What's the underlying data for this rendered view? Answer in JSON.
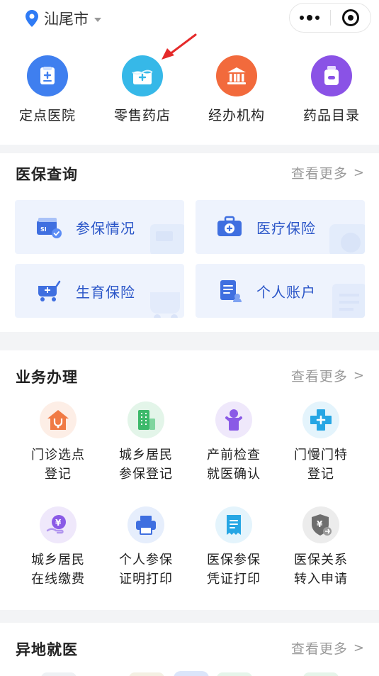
{
  "topbar": {
    "city": "汕尾市"
  },
  "quick_nav": [
    {
      "label": "定点医院",
      "icon": "hospital-icon",
      "color": "#3f7fef"
    },
    {
      "label": "零售药店",
      "icon": "pharmacy-icon",
      "color": "#36b8e8"
    },
    {
      "label": "经办机构",
      "icon": "institution-icon",
      "color": "#f26a3c"
    },
    {
      "label": "药品目录",
      "icon": "medicine-bottle-icon",
      "color": "#8a52e6"
    }
  ],
  "query": {
    "title": "医保查询",
    "more": "查看更多",
    "cards": [
      {
        "label": "参保情况",
        "icon": "insured-card-icon"
      },
      {
        "label": "医疗保险",
        "icon": "medical-kit-icon"
      },
      {
        "label": "生育保险",
        "icon": "stroller-icon"
      },
      {
        "label": "个人账户",
        "icon": "account-document-icon"
      }
    ]
  },
  "business": {
    "title": "业务办理",
    "more": "查看更多",
    "items": [
      {
        "label": "门诊选点\n登记",
        "icon": "clinic-house-icon"
      },
      {
        "label": "城乡居民\n参保登记",
        "icon": "building-icon"
      },
      {
        "label": "产前检查\n就医确认",
        "icon": "baby-icon"
      },
      {
        "label": "门慢门特\n登记",
        "icon": "cross-icon"
      },
      {
        "label": "城乡居民\n在线缴费",
        "icon": "yuan-hand-icon"
      },
      {
        "label": "个人参保\n证明打印",
        "icon": "printer-icon"
      },
      {
        "label": "医保参保\n凭证打印",
        "icon": "receipt-icon"
      },
      {
        "label": "医保关系\n转入申请",
        "icon": "shield-yuan-icon"
      }
    ]
  },
  "remote": {
    "title": "异地就医",
    "more": "查看更多"
  },
  "colors": {
    "accent": "#2b56c8",
    "card_bg": "#eef3fd",
    "annotation_arrow": "#e52a2a"
  }
}
